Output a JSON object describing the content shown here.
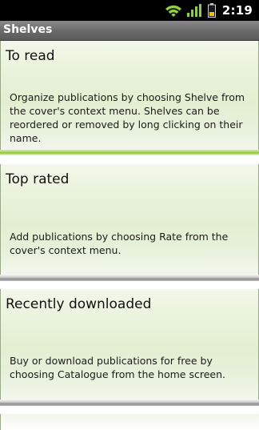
{
  "status_bar": {
    "time": "2:19",
    "icons": [
      "wifi-icon",
      "signal-icon",
      "battery-icon"
    ],
    "accent": "#9acd32"
  },
  "title_bar": {
    "title": "Shelves"
  },
  "shelves": [
    {
      "title": "To read",
      "description": "Organize publications by choosing Shelve from the cover's context menu. Shelves can be reordered or removed by long clicking on their name."
    },
    {
      "title": "Top rated",
      "description": "Add publications by choosing Rate from the cover's context menu."
    },
    {
      "title": "Recently downloaded",
      "description": "Buy or download publications for free by choosing Catalogue from the home screen."
    }
  ]
}
